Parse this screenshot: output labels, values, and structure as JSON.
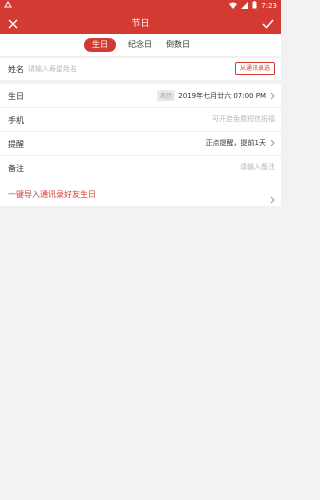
{
  "status": {
    "time": "7:23",
    "icons": [
      "signal-icon",
      "wifi-icon",
      "battery-icon"
    ]
  },
  "appbar": {
    "title": "节日"
  },
  "tabs": [
    {
      "label": "生日",
      "active": true
    },
    {
      "label": "纪念日",
      "active": false
    },
    {
      "label": "倒数日",
      "active": false
    }
  ],
  "name_row": {
    "label": "姓名",
    "placeholder": "请输入寿星姓名",
    "contacts_button": "从通讯录选"
  },
  "details": [
    {
      "label": "生日",
      "badge": "农历",
      "value": "2019年七月廿六 07:00 PM",
      "has_chevron": true
    },
    {
      "label": "手机",
      "value": "可开启免费短信祝福",
      "has_chevron": false
    },
    {
      "label": "提醒",
      "value": "正点提醒，提前1天",
      "has_chevron": true
    },
    {
      "label": "备注",
      "value": "请输入备注",
      "has_chevron": false
    }
  ],
  "import": {
    "label": "一键导入通讯录好友生日"
  },
  "colors": {
    "accent": "#d33a32",
    "page_bg": "#f2f2f2"
  }
}
